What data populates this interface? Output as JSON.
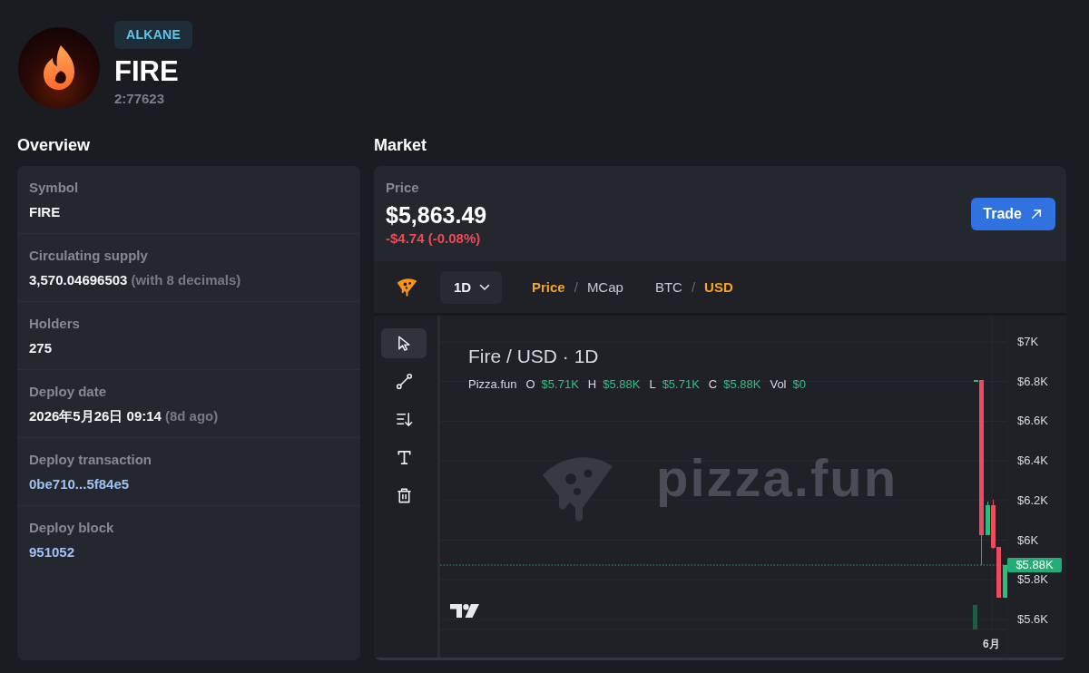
{
  "token": {
    "badge": "ALKANE",
    "name": "FIRE",
    "id": "2:77623"
  },
  "overview": {
    "title": "Overview",
    "rows": [
      {
        "label": "Symbol",
        "value": "FIRE",
        "kind": "text"
      },
      {
        "label": "Circulating supply",
        "value": "3,570.04696503",
        "note": "(with 8 decimals)",
        "kind": "text"
      },
      {
        "label": "Holders",
        "value": "275",
        "kind": "text"
      },
      {
        "label": "Deploy date",
        "value": "2026年5月26日 09:14",
        "note": "(8d ago)",
        "kind": "text"
      },
      {
        "label": "Deploy transaction",
        "value": "0be710...5f84e5",
        "kind": "link"
      },
      {
        "label": "Deploy block",
        "value": "951052",
        "kind": "link"
      }
    ]
  },
  "market": {
    "title": "Market",
    "price": {
      "label": "Price",
      "value": "$5,863.49",
      "change": "-$4.74 (-0.08%)",
      "negative": true
    },
    "trade_button": "Trade",
    "toolbar": {
      "interval": "1D",
      "groups": [
        {
          "separator": "/",
          "options": [
            {
              "label": "Price",
              "selected": true
            },
            {
              "label": "MCap",
              "selected": false
            }
          ]
        },
        {
          "separator": "/",
          "options": [
            {
              "label": "BTC",
              "selected": false
            },
            {
              "label": "USD",
              "selected": true
            }
          ]
        }
      ]
    },
    "tools": [
      {
        "kind": "cursor",
        "selected": true
      },
      {
        "kind": "line",
        "selected": false
      },
      {
        "kind": "sort",
        "selected": false
      },
      {
        "kind": "text",
        "selected": false
      },
      {
        "kind": "trash",
        "selected": false
      }
    ],
    "chart": {
      "title": "Fire / USD · 1D",
      "source": "Pizza.fun",
      "legend": [
        {
          "key": "O",
          "value": "$5.71K"
        },
        {
          "key": "H",
          "value": "$5.88K"
        },
        {
          "key": "L",
          "value": "$5.71K"
        },
        {
          "key": "C",
          "value": "$5.88K"
        },
        {
          "key": "Vol",
          "value": "$0"
        }
      ],
      "watermark": "pizza.fun",
      "price_axis": [
        "$7K",
        "$6.8K",
        "$6.6K",
        "$6.4K",
        "$6.2K",
        "$6K",
        "$5.8K",
        "$5.6K"
      ],
      "last_price": "$5.88K",
      "time_axis": [
        "6月"
      ]
    }
  }
}
